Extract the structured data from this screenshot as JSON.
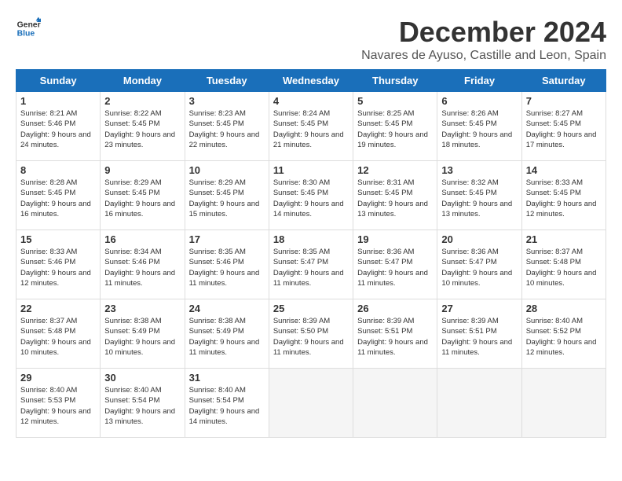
{
  "logo": {
    "line1": "General",
    "line2": "Blue"
  },
  "title": "December 2024",
  "subtitle": "Navares de Ayuso, Castille and Leon, Spain",
  "weekdays": [
    "Sunday",
    "Monday",
    "Tuesday",
    "Wednesday",
    "Thursday",
    "Friday",
    "Saturday"
  ],
  "days": [
    {
      "num": "",
      "info": ""
    },
    {
      "num": "2",
      "info": "Sunrise: 8:22 AM\nSunset: 5:45 PM\nDaylight: 9 hours\nand 23 minutes."
    },
    {
      "num": "3",
      "info": "Sunrise: 8:23 AM\nSunset: 5:45 PM\nDaylight: 9 hours\nand 22 minutes."
    },
    {
      "num": "4",
      "info": "Sunrise: 8:24 AM\nSunset: 5:45 PM\nDaylight: 9 hours\nand 21 minutes."
    },
    {
      "num": "5",
      "info": "Sunrise: 8:25 AM\nSunset: 5:45 PM\nDaylight: 9 hours\nand 19 minutes."
    },
    {
      "num": "6",
      "info": "Sunrise: 8:26 AM\nSunset: 5:45 PM\nDaylight: 9 hours\nand 18 minutes."
    },
    {
      "num": "7",
      "info": "Sunrise: 8:27 AM\nSunset: 5:45 PM\nDaylight: 9 hours\nand 17 minutes."
    },
    {
      "num": "8",
      "info": "Sunrise: 8:28 AM\nSunset: 5:45 PM\nDaylight: 9 hours\nand 16 minutes."
    },
    {
      "num": "9",
      "info": "Sunrise: 8:29 AM\nSunset: 5:45 PM\nDaylight: 9 hours\nand 16 minutes."
    },
    {
      "num": "10",
      "info": "Sunrise: 8:29 AM\nSunset: 5:45 PM\nDaylight: 9 hours\nand 15 minutes."
    },
    {
      "num": "11",
      "info": "Sunrise: 8:30 AM\nSunset: 5:45 PM\nDaylight: 9 hours\nand 14 minutes."
    },
    {
      "num": "12",
      "info": "Sunrise: 8:31 AM\nSunset: 5:45 PM\nDaylight: 9 hours\nand 13 minutes."
    },
    {
      "num": "13",
      "info": "Sunrise: 8:32 AM\nSunset: 5:45 PM\nDaylight: 9 hours\nand 13 minutes."
    },
    {
      "num": "14",
      "info": "Sunrise: 8:33 AM\nSunset: 5:45 PM\nDaylight: 9 hours\nand 12 minutes."
    },
    {
      "num": "15",
      "info": "Sunrise: 8:33 AM\nSunset: 5:46 PM\nDaylight: 9 hours\nand 12 minutes."
    },
    {
      "num": "16",
      "info": "Sunrise: 8:34 AM\nSunset: 5:46 PM\nDaylight: 9 hours\nand 11 minutes."
    },
    {
      "num": "17",
      "info": "Sunrise: 8:35 AM\nSunset: 5:46 PM\nDaylight: 9 hours\nand 11 minutes."
    },
    {
      "num": "18",
      "info": "Sunrise: 8:35 AM\nSunset: 5:47 PM\nDaylight: 9 hours\nand 11 minutes."
    },
    {
      "num": "19",
      "info": "Sunrise: 8:36 AM\nSunset: 5:47 PM\nDaylight: 9 hours\nand 11 minutes."
    },
    {
      "num": "20",
      "info": "Sunrise: 8:36 AM\nSunset: 5:47 PM\nDaylight: 9 hours\nand 10 minutes."
    },
    {
      "num": "21",
      "info": "Sunrise: 8:37 AM\nSunset: 5:48 PM\nDaylight: 9 hours\nand 10 minutes."
    },
    {
      "num": "22",
      "info": "Sunrise: 8:37 AM\nSunset: 5:48 PM\nDaylight: 9 hours\nand 10 minutes."
    },
    {
      "num": "23",
      "info": "Sunrise: 8:38 AM\nSunset: 5:49 PM\nDaylight: 9 hours\nand 10 minutes."
    },
    {
      "num": "24",
      "info": "Sunrise: 8:38 AM\nSunset: 5:49 PM\nDaylight: 9 hours\nand 11 minutes."
    },
    {
      "num": "25",
      "info": "Sunrise: 8:39 AM\nSunset: 5:50 PM\nDaylight: 9 hours\nand 11 minutes."
    },
    {
      "num": "26",
      "info": "Sunrise: 8:39 AM\nSunset: 5:51 PM\nDaylight: 9 hours\nand 11 minutes."
    },
    {
      "num": "27",
      "info": "Sunrise: 8:39 AM\nSunset: 5:51 PM\nDaylight: 9 hours\nand 11 minutes."
    },
    {
      "num": "28",
      "info": "Sunrise: 8:40 AM\nSunset: 5:52 PM\nDaylight: 9 hours\nand 12 minutes."
    },
    {
      "num": "29",
      "info": "Sunrise: 8:40 AM\nSunset: 5:53 PM\nDaylight: 9 hours\nand 12 minutes."
    },
    {
      "num": "30",
      "info": "Sunrise: 8:40 AM\nSunset: 5:54 PM\nDaylight: 9 hours\nand 13 minutes."
    },
    {
      "num": "31",
      "info": "Sunrise: 8:40 AM\nSunset: 5:54 PM\nDaylight: 9 hours\nand 14 minutes."
    }
  ],
  "day1": {
    "num": "1",
    "info": "Sunrise: 8:21 AM\nSunset: 5:46 PM\nDaylight: 9 hours\nand 24 minutes."
  }
}
